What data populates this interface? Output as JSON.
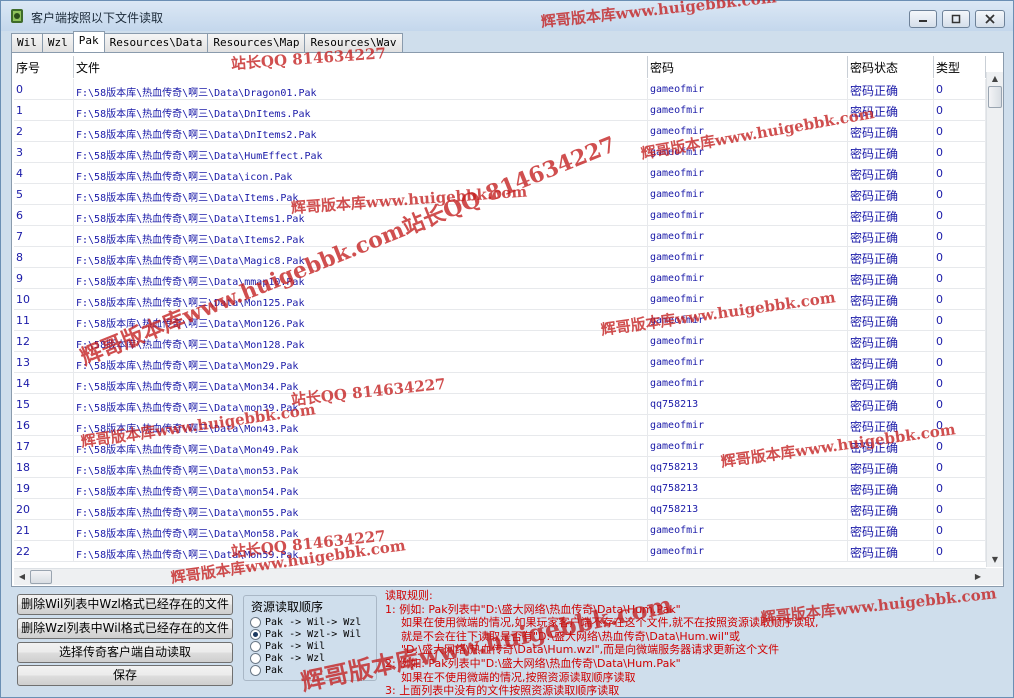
{
  "window": {
    "title": "客户端按照以下文件读取",
    "minimize": "–",
    "maximize": "□",
    "close": "✕"
  },
  "tabs": [
    "Wil",
    "Wzl",
    "Pak",
    "Resources\\Data",
    "Resources\\Map",
    "Resources\\Wav"
  ],
  "active_tab": "Pak",
  "table": {
    "columns": [
      "序号",
      "文件",
      "密码",
      "密码状态",
      "类型"
    ],
    "rows": [
      [
        "0",
        "F:\\58版本库\\热血传奇\\啊三\\Data\\Dragon01.Pak",
        "gameofmir",
        "密码正确",
        "0"
      ],
      [
        "1",
        "F:\\58版本库\\热血传奇\\啊三\\Data\\DnItems.Pak",
        "gameofmir",
        "密码正确",
        "0"
      ],
      [
        "2",
        "F:\\58版本库\\热血传奇\\啊三\\Data\\DnItems2.Pak",
        "gameofmir",
        "密码正确",
        "0"
      ],
      [
        "3",
        "F:\\58版本库\\热血传奇\\啊三\\Data\\HumEffect.Pak",
        "gameofmir",
        "密码正确",
        "0"
      ],
      [
        "4",
        "F:\\58版本库\\热血传奇\\啊三\\Data\\icon.Pak",
        "gameofmir",
        "密码正确",
        "0"
      ],
      [
        "5",
        "F:\\58版本库\\热血传奇\\啊三\\Data\\Items.Pak",
        "gameofmir",
        "密码正确",
        "0"
      ],
      [
        "6",
        "F:\\58版本库\\热血传奇\\啊三\\Data\\Items1.Pak",
        "gameofmir",
        "密码正确",
        "0"
      ],
      [
        "7",
        "F:\\58版本库\\热血传奇\\啊三\\Data\\Items2.Pak",
        "gameofmir",
        "密码正确",
        "0"
      ],
      [
        "8",
        "F:\\58版本库\\热血传奇\\啊三\\Data\\Magic8.Pak",
        "gameofmir",
        "密码正确",
        "0"
      ],
      [
        "9",
        "F:\\58版本库\\热血传奇\\啊三\\Data\\mmap10.Pak",
        "gameofmir",
        "密码正确",
        "0"
      ],
      [
        "10",
        "F:\\58版本库\\热血传奇\\啊三\\Data\\Mon125.Pak",
        "gameofmir",
        "密码正确",
        "0"
      ],
      [
        "11",
        "F:\\58版本库\\热血传奇\\啊三\\Data\\Mon126.Pak",
        "gameofmir",
        "密码正确",
        "0"
      ],
      [
        "12",
        "F:\\58版本库\\热血传奇\\啊三\\Data\\Mon128.Pak",
        "gameofmir",
        "密码正确",
        "0"
      ],
      [
        "13",
        "F:\\58版本库\\热血传奇\\啊三\\Data\\Mon29.Pak",
        "gameofmir",
        "密码正确",
        "0"
      ],
      [
        "14",
        "F:\\58版本库\\热血传奇\\啊三\\Data\\Mon34.Pak",
        "gameofmir",
        "密码正确",
        "0"
      ],
      [
        "15",
        "F:\\58版本库\\热血传奇\\啊三\\Data\\mon39.Pak",
        "qq758213",
        "密码正确",
        "0"
      ],
      [
        "16",
        "F:\\58版本库\\热血传奇\\啊三\\Data\\Mon43.Pak",
        "gameofmir",
        "密码正确",
        "0"
      ],
      [
        "17",
        "F:\\58版本库\\热血传奇\\啊三\\Data\\Mon49.Pak",
        "gameofmir",
        "密码正确",
        "0"
      ],
      [
        "18",
        "F:\\58版本库\\热血传奇\\啊三\\Data\\mon53.Pak",
        "qq758213",
        "密码正确",
        "0"
      ],
      [
        "19",
        "F:\\58版本库\\热血传奇\\啊三\\Data\\mon54.Pak",
        "qq758213",
        "密码正确",
        "0"
      ],
      [
        "20",
        "F:\\58版本库\\热血传奇\\啊三\\Data\\mon55.Pak",
        "qq758213",
        "密码正确",
        "0"
      ],
      [
        "21",
        "F:\\58版本库\\热血传奇\\啊三\\Data\\Mon58.Pak",
        "gameofmir",
        "密码正确",
        "0"
      ],
      [
        "22",
        "F:\\58版本库\\热血传奇\\啊三\\Data\\Mon59.Pak",
        "gameofmir",
        "密码正确",
        "0"
      ]
    ]
  },
  "buttons": {
    "delete_wil": "删除Wil列表中Wzl格式已经存在的文件",
    "delete_wzl": "删除Wzl列表中Wil格式已经存在的文件",
    "select_client": "选择传奇客户端自动读取",
    "save": "保存"
  },
  "read_order": {
    "title": "资源读取顺序",
    "options": [
      "Pak -> Wil-> Wzl",
      "Pak -> Wzl-> Wil",
      "Pak -> Wil",
      "Pak -> Wzl",
      "Pak"
    ],
    "selected_index": 1
  },
  "rules": {
    "title": "读取规则:",
    "lines": [
      "1: 例如: Pak列表中\"D:\\盛大网络\\热血传奇\\Data\\Hum.Pak\"",
      "如果在使用微端的情况,如果玩家客户端不存在这个文件,就不在按照资源读取顺序读取,",
      "就是不会在往下读取是否有\"D:\\盛大网络\\热血传奇\\Data\\Hum.wil\"或",
      "\"D:\\盛大网络\\热血传奇\\Data\\Hum.wzl\",而是向微端服务器请求更新这个文件",
      "2: 例如: Pak列表中\"D:\\盛大网络\\热血传奇\\Data\\Hum.Pak\"",
      "如果在不使用微端的情况,按照资源读取顺序读取",
      "3: 上面列表中没有的文件按照资源读取顺序读取"
    ]
  },
  "watermarks": [
    "辉哥版本库www.huigebbk.com",
    "站长QQ 814634227",
    "辉哥版本库www.huigebbk.com站长QQ 814634227"
  ],
  "colors": {
    "cell_text": "#1a1aa8",
    "rules_text": "#d00000",
    "watermark": "#c41e1e",
    "window_bg": "#cfdeec"
  }
}
